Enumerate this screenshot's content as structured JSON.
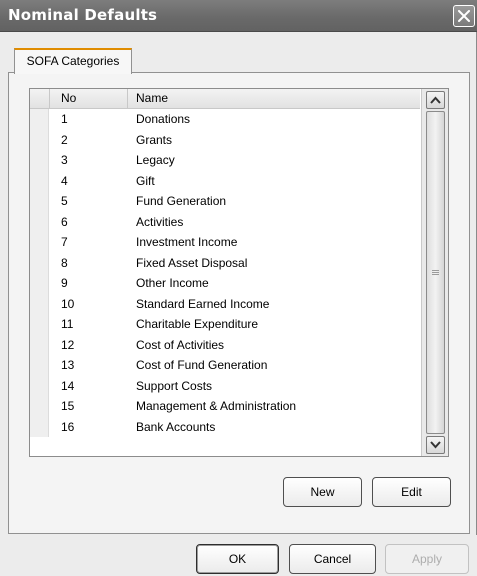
{
  "window": {
    "title": "Nominal Defaults",
    "close_label": "✕"
  },
  "tab": {
    "label": "SOFA Categories"
  },
  "list": {
    "columns": [
      "No",
      "Name"
    ],
    "rows": [
      {
        "no": "1",
        "name": "Donations"
      },
      {
        "no": "2",
        "name": "Grants"
      },
      {
        "no": "3",
        "name": "Legacy"
      },
      {
        "no": "4",
        "name": "Gift"
      },
      {
        "no": "5",
        "name": "Fund Generation"
      },
      {
        "no": "6",
        "name": "Activities"
      },
      {
        "no": "7",
        "name": "Investment Income"
      },
      {
        "no": "8",
        "name": "Fixed Asset Disposal"
      },
      {
        "no": "9",
        "name": "Other Income"
      },
      {
        "no": "10",
        "name": "Standard Earned Income"
      },
      {
        "no": "11",
        "name": "Charitable Expenditure"
      },
      {
        "no": "12",
        "name": "Cost of Activities"
      },
      {
        "no": "13",
        "name": "Cost of Fund Generation"
      },
      {
        "no": "14",
        "name": "Support Costs"
      },
      {
        "no": "15",
        "name": "Management & Administration"
      },
      {
        "no": "16",
        "name": "Bank Accounts"
      }
    ]
  },
  "buttons": {
    "new": "New",
    "edit": "Edit",
    "ok": "OK",
    "cancel": "Cancel",
    "apply": "Apply"
  }
}
